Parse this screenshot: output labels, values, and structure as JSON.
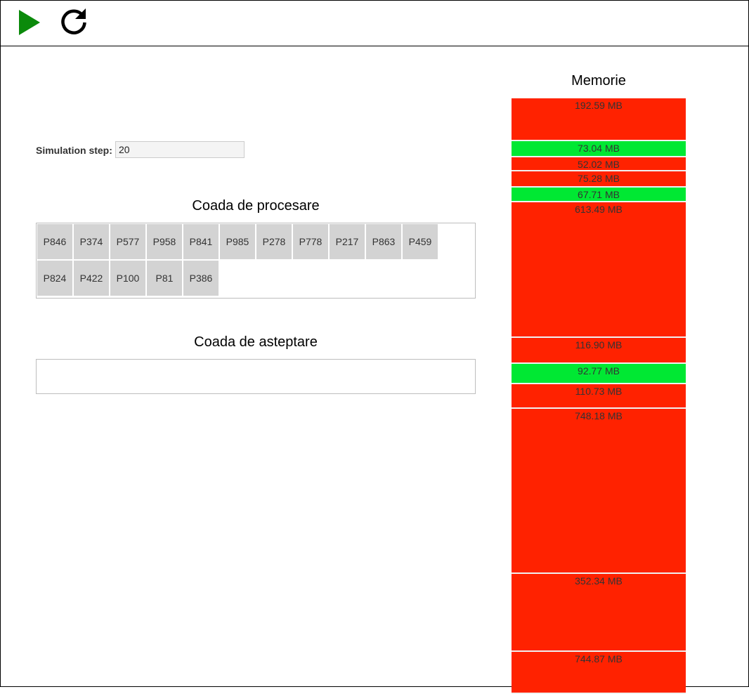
{
  "toolbar": {
    "play_icon": "play-icon",
    "reset_icon": "refresh-icon",
    "play_color": "#0b8a0b",
    "reset_color": "#000000"
  },
  "simulation": {
    "label": "Simulation step:",
    "value": "20"
  },
  "processing_queue": {
    "title": "Coada de procesare",
    "items": [
      "P846",
      "P374",
      "P577",
      "P958",
      "P841",
      "P985",
      "P278",
      "P778",
      "P217",
      "P863",
      "P459",
      "P824",
      "P422",
      "P100",
      "P81",
      "P386"
    ]
  },
  "waiting_queue": {
    "title": "Coada de asteptare",
    "items": []
  },
  "memory": {
    "title": "Memorie",
    "colors": {
      "used": "#ff2200",
      "free": "#00e833"
    },
    "blocks": [
      {
        "label": "192.59 MB",
        "state": "used"
      },
      {
        "label": "73.04 MB",
        "state": "free"
      },
      {
        "label": "52.02 MB",
        "state": "used"
      },
      {
        "label": "75.28 MB",
        "state": "used"
      },
      {
        "label": "67.71 MB",
        "state": "free"
      },
      {
        "label": "613.49 MB",
        "state": "used"
      },
      {
        "label": "116.90 MB",
        "state": "used"
      },
      {
        "label": "92.77 MB",
        "state": "free"
      },
      {
        "label": "110.73 MB",
        "state": "used"
      },
      {
        "label": "748.18 MB",
        "state": "used"
      },
      {
        "label": "352.34 MB",
        "state": "used"
      },
      {
        "label": "744.87 MB",
        "state": "used"
      }
    ]
  }
}
